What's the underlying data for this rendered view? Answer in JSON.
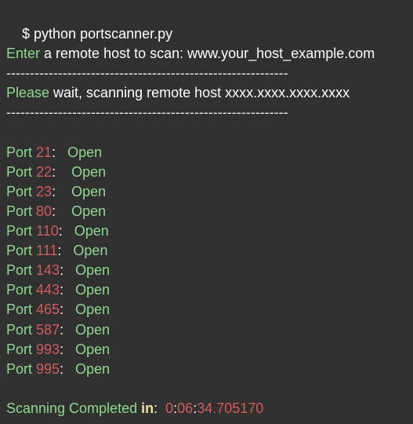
{
  "prompt": "$ python portscanner.py",
  "enter_line": {
    "keyword": "Enter",
    "text": " a remote host to scan: www.your_host_example.com"
  },
  "divider": "------------------------------------------------------------",
  "wait_line": {
    "keyword": "Please",
    "text": " wait, scanning remote host xxxx.xxxx.xxxx.xxxx"
  },
  "ports": [
    {
      "label": "Port",
      "number": "21",
      "sep": ":   ",
      "status": "Open"
    },
    {
      "label": "Port",
      "number": "22",
      "sep": ":    ",
      "status": "Open"
    },
    {
      "label": "Port",
      "number": "23",
      "sep": ":    ",
      "status": "Open"
    },
    {
      "label": "Port",
      "number": "80",
      "sep": ":    ",
      "status": "Open"
    },
    {
      "label": "Port",
      "number": "110",
      "sep": ":   ",
      "status": "Open"
    },
    {
      "label": "Port",
      "number": "111",
      "sep": ":   ",
      "status": "Open"
    },
    {
      "label": "Port",
      "number": "143",
      "sep": ":   ",
      "status": "Open"
    },
    {
      "label": "Port",
      "number": "443",
      "sep": ":   ",
      "status": "Open"
    },
    {
      "label": "Port",
      "number": "465",
      "sep": ":   ",
      "status": "Open"
    },
    {
      "label": "Port",
      "number": "587",
      "sep": ":   ",
      "status": "Open"
    },
    {
      "label": "Port",
      "number": "993",
      "sep": ":   ",
      "status": "Open"
    },
    {
      "label": "Port",
      "number": "995",
      "sep": ":   ",
      "status": "Open"
    }
  ],
  "completed": {
    "label": "Scanning Completed",
    "keyword": "in",
    "colon": ":  ",
    "h": "0",
    "m": "06",
    "s": "34.705170"
  },
  "colors": {
    "background": "#303030",
    "keyword_green": "#8fd98f",
    "number_red": "#d35a5a",
    "text_white": "#ffffff",
    "keyword_yellow": "#f0e2a0"
  }
}
